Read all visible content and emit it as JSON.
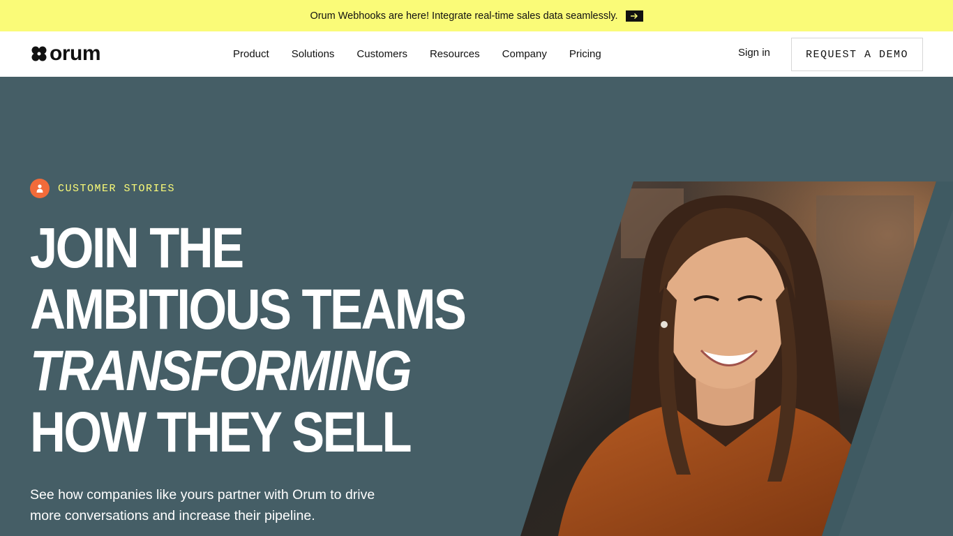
{
  "banner": {
    "text": "Orum Webhooks are here! Integrate real-time sales data seamlessly.",
    "arrow_icon": "arrow-right-icon"
  },
  "nav": {
    "logo_text": "orum",
    "links": [
      "Product",
      "Solutions",
      "Customers",
      "Resources",
      "Company",
      "Pricing"
    ],
    "signin": "Sign in",
    "cta": "REQUEST A DEMO"
  },
  "hero": {
    "tag": "CUSTOMER STORIES",
    "tag_icon": "person-icon",
    "headline": [
      "JOIN THE",
      "AMBITIOUS TEAMS",
      "TRANSFORMING",
      "HOW THEY SELL"
    ],
    "subtext_line1": "See how companies like yours partner with Orum to drive",
    "subtext_line2": "more conversations and increase their pipeline.",
    "image_alt": "smiling-woman-photo"
  },
  "colors": {
    "banner_bg": "#fafb78",
    "hero_bg": "#455e66",
    "accent_yellow": "#fafb78",
    "tag_orange": "#f26b3a",
    "text_dark": "#111111"
  }
}
